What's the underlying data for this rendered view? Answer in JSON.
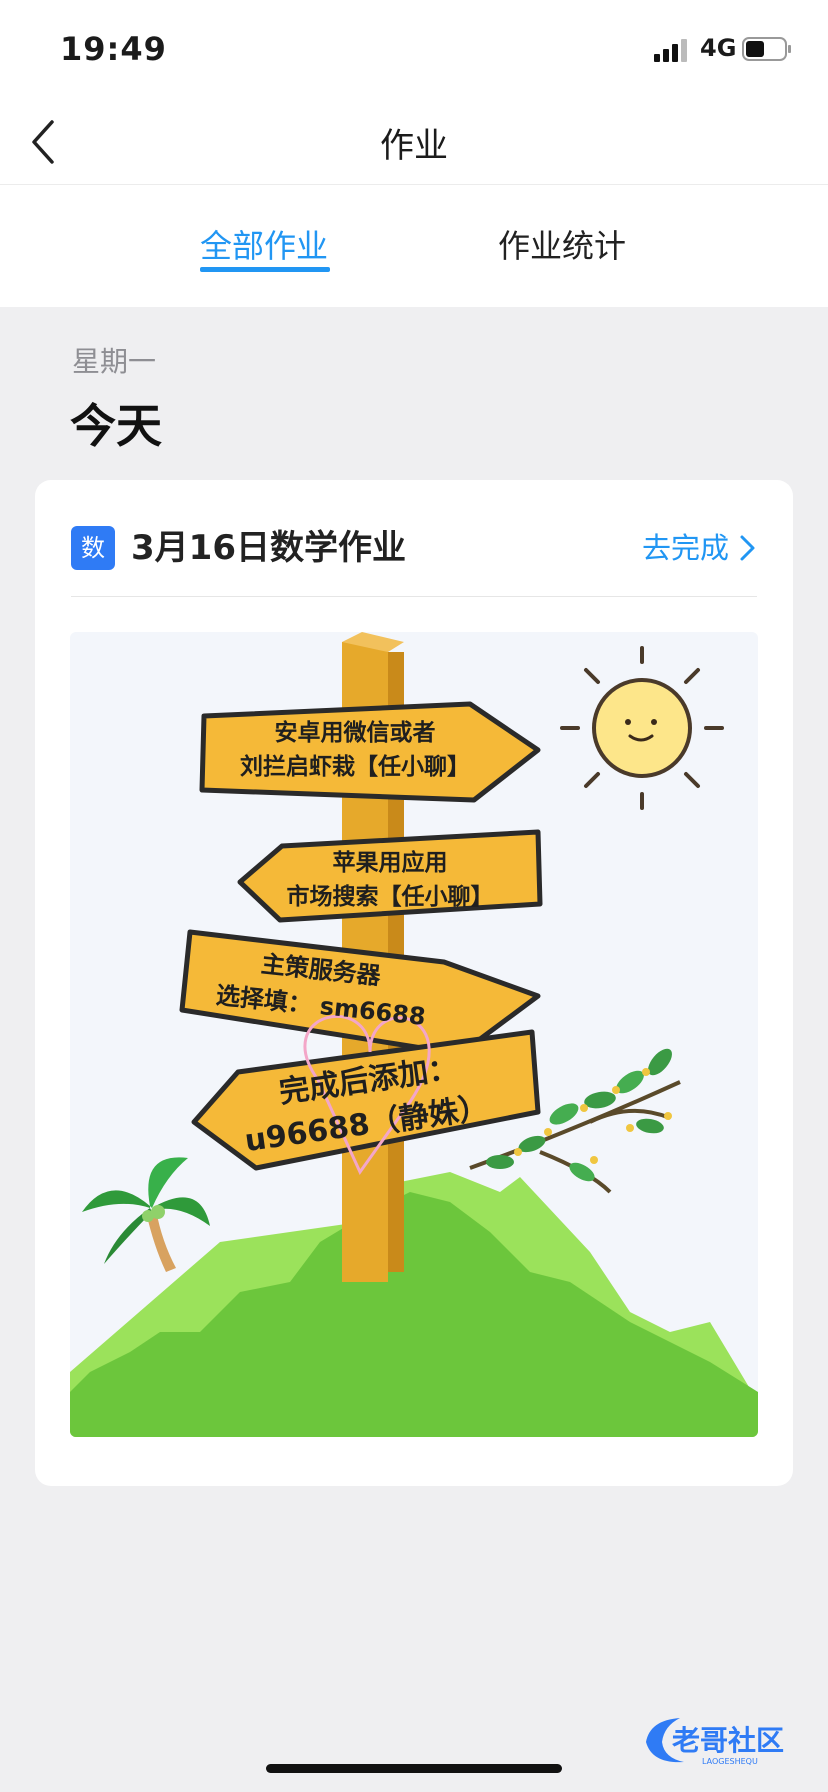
{
  "status_bar": {
    "time": "19:49",
    "network": "4G",
    "signal_icon": "signal-bars-icon",
    "battery_icon": "battery-icon"
  },
  "nav": {
    "title": "作业",
    "back_icon": "chevron-left-icon"
  },
  "tabs": [
    {
      "label": "全部作业",
      "active": true
    },
    {
      "label": "作业统计",
      "active": false
    }
  ],
  "day": {
    "weekday": "星期一",
    "label": "今天"
  },
  "assignment": {
    "subject_badge": "数",
    "title": "3月16日数学作业",
    "action_label": "去完成",
    "action_icon": "chevron-right-icon",
    "image": {
      "sign1_line1": "安卓用微信或者",
      "sign1_line2": "刘拦启虾栽【任小聊】",
      "sign2_line1": "苹果用应用",
      "sign2_line2": "市场搜索【任小聊】",
      "sign3_line1": "主策服务器",
      "sign3_line2": "选择填： sm6688",
      "sign4_line1": "完成后添加：",
      "sign4_line2": "u96688（静姝）"
    }
  },
  "watermark": {
    "main": "老哥社区",
    "sub": "LAOGESHEQU"
  },
  "colors": {
    "accent": "#2196f3",
    "badge": "#2f7bf5",
    "background": "#efeff1"
  }
}
